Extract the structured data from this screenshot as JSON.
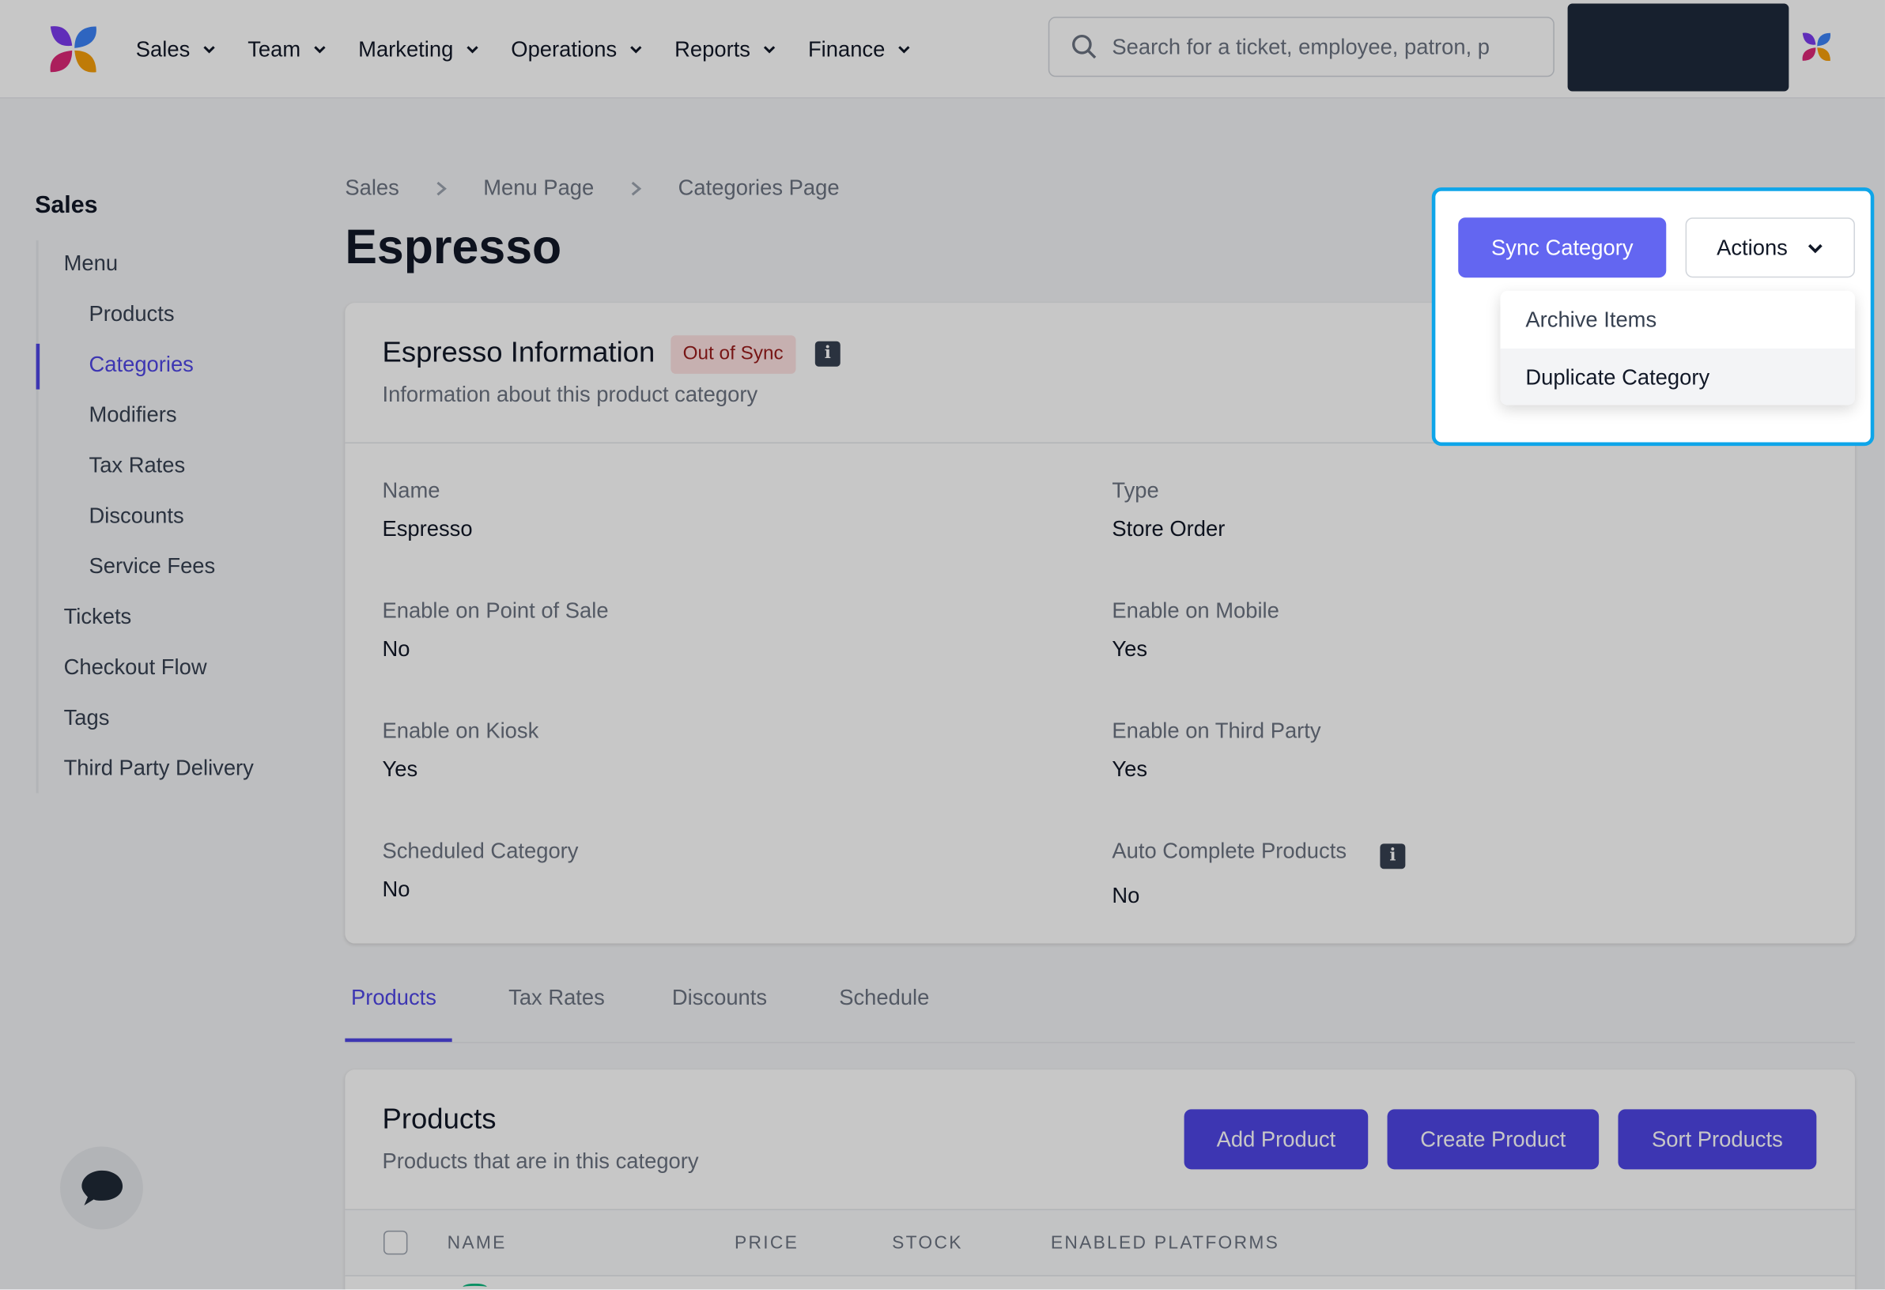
{
  "nav": {
    "items": [
      {
        "label": "Sales"
      },
      {
        "label": "Team"
      },
      {
        "label": "Marketing"
      },
      {
        "label": "Operations"
      },
      {
        "label": "Reports"
      },
      {
        "label": "Finance"
      }
    ],
    "search_placeholder": "Search for a ticket, employee, patron, p"
  },
  "sidebar": {
    "title": "Sales",
    "items": [
      {
        "label": "Menu"
      },
      {
        "label": "Products"
      },
      {
        "label": "Categories"
      },
      {
        "label": "Modifiers"
      },
      {
        "label": "Tax Rates"
      },
      {
        "label": "Discounts"
      },
      {
        "label": "Service Fees"
      },
      {
        "label": "Tickets"
      },
      {
        "label": "Checkout Flow"
      },
      {
        "label": "Tags"
      },
      {
        "label": "Third Party Delivery"
      }
    ],
    "active": "Categories"
  },
  "breadcrumb": [
    "Sales",
    "Menu Page",
    "Categories Page"
  ],
  "page_title": "Espresso",
  "header_actions": {
    "sync_label": "Sync Category",
    "actions_label": "Actions",
    "menu": [
      {
        "label": "Archive Items"
      },
      {
        "label": "Duplicate Category"
      }
    ]
  },
  "info_card": {
    "title": "Espresso Information",
    "badge": "Out of Sync",
    "subtitle": "Information about this product category",
    "fields": [
      {
        "label": "Name",
        "value": "Espresso"
      },
      {
        "label": "Type",
        "value": "Store Order"
      },
      {
        "label": "Enable on Point of Sale",
        "value": "No"
      },
      {
        "label": "Enable on Mobile",
        "value": "Yes"
      },
      {
        "label": "Enable on Kiosk",
        "value": "Yes"
      },
      {
        "label": "Enable on Third Party",
        "value": "Yes"
      },
      {
        "label": "Scheduled Category",
        "value": "No"
      },
      {
        "label": "Auto Complete Products",
        "value": "No"
      }
    ]
  },
  "tabs": [
    {
      "label": "Products"
    },
    {
      "label": "Tax Rates"
    },
    {
      "label": "Discounts"
    },
    {
      "label": "Schedule"
    }
  ],
  "products_card": {
    "title": "Products",
    "subtitle": "Products that are in this category",
    "buttons": [
      {
        "label": "Add Product"
      },
      {
        "label": "Create Product"
      },
      {
        "label": "Sort Products"
      }
    ],
    "columns": [
      "NAME",
      "PRICE",
      "STOCK",
      "ENABLED PLATFORMS"
    ]
  },
  "colors": {
    "accent": "#4f46e5",
    "sync_button": "#6366f1",
    "highlight_border": "#0ea5e9",
    "badge_bg": "#fee2e2",
    "badge_text": "#991b1b"
  }
}
